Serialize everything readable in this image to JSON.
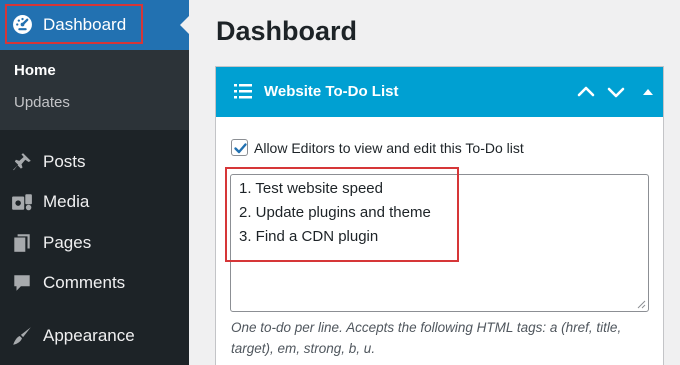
{
  "sidebar": {
    "dashboard_label": "Dashboard",
    "submenu": {
      "home": "Home",
      "updates": "Updates"
    },
    "items": [
      {
        "label": "Posts",
        "icon": "pin-icon"
      },
      {
        "label": "Media",
        "icon": "media-icon"
      },
      {
        "label": "Pages",
        "icon": "pages-icon"
      },
      {
        "label": "Comments",
        "icon": "comment-icon"
      },
      {
        "label": "Appearance",
        "icon": "brush-icon"
      }
    ]
  },
  "main": {
    "page_title": "Dashboard",
    "widget": {
      "title": "Website To-Do List",
      "checkbox_label": "Allow Editors to view and edit this To-Do list",
      "checkbox_checked": true,
      "todo_lines": [
        "1. Test website speed",
        "2. Update plugins and theme",
        "3. Find a CDN plugin"
      ],
      "hint": "One to-do per line. Accepts the following HTML tags: a (href, title, target), em, strong, b, u."
    }
  },
  "colors": {
    "sidebar": "#1d2327",
    "accent": "#2271b1",
    "widget_header": "#00a0d2",
    "highlight": "#d63638"
  }
}
